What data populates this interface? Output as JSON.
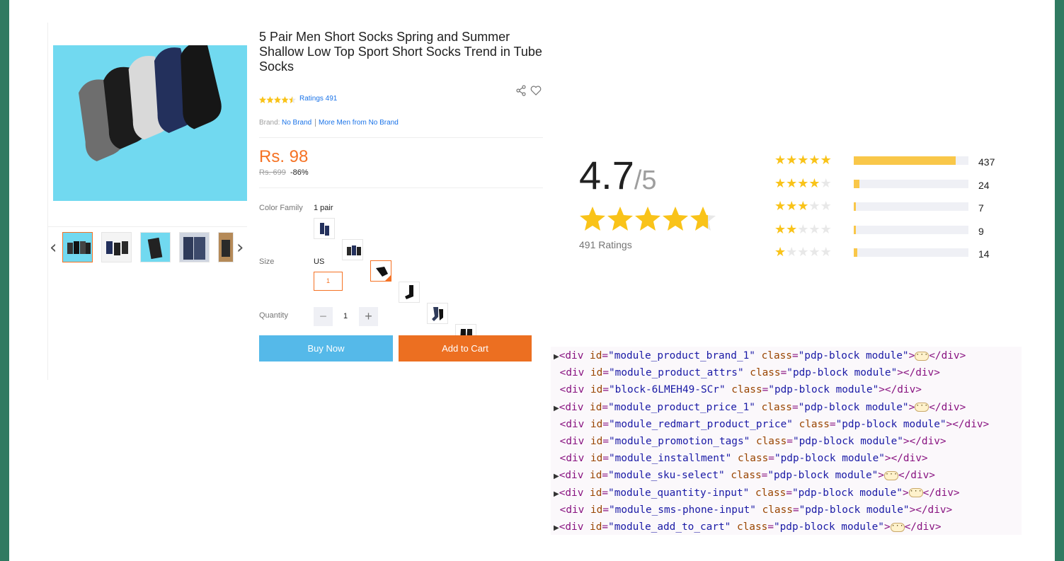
{
  "product": {
    "title": "5 Pair Men Short Socks Spring and Summer Shallow Low Top Sport Short Socks Trend in Tube Socks",
    "ratings_link": "Ratings 491",
    "brand_label": "Brand:",
    "brand_name": "No Brand",
    "brand_more": "More Men from No Brand",
    "price": "Rs. 98",
    "old_price": "Rs. 699",
    "discount": "-86%",
    "color_label": "Color Family",
    "color_value": "1 pair",
    "size_label": "Size",
    "size_system": "US",
    "size_option": "1",
    "quantity_label": "Quantity",
    "quantity": "1",
    "buy_now": "Buy Now",
    "add_to_cart": "Add to Cart",
    "rating_small": 4.5
  },
  "rating_summary": {
    "score": "4.7",
    "out_of": "/5",
    "average": 4.7,
    "ratings_text": "491 Ratings",
    "breakdown": [
      {
        "stars": 5,
        "count": "437",
        "fraction": 0.89
      },
      {
        "stars": 4,
        "count": "24",
        "fraction": 0.05
      },
      {
        "stars": 3,
        "count": "7",
        "fraction": 0.015
      },
      {
        "stars": 2,
        "count": "9",
        "fraction": 0.018
      },
      {
        "stars": 1,
        "count": "14",
        "fraction": 0.028
      }
    ]
  },
  "devtools_lines": [
    {
      "expandable": true,
      "id": "module_product_brand_1",
      "class": "pdp-block module",
      "collapsed": true
    },
    {
      "expandable": false,
      "id": "module_product_attrs",
      "class": "pdp-block module",
      "collapsed": false
    },
    {
      "expandable": false,
      "id": "block-6LMEH49-SCr",
      "class": "pdp-block module",
      "collapsed": false
    },
    {
      "expandable": true,
      "id": "module_product_price_1",
      "class": "pdp-block module",
      "collapsed": true
    },
    {
      "expandable": false,
      "id": "module_redmart_product_price",
      "class": "pdp-block module",
      "collapsed": false
    },
    {
      "expandable": false,
      "id": "module_promotion_tags",
      "class": "pdp-block module",
      "collapsed": false
    },
    {
      "expandable": false,
      "id": "module_installment",
      "class": "pdp-block module",
      "collapsed": false
    },
    {
      "expandable": true,
      "id": "module_sku-select",
      "class": "pdp-block module",
      "collapsed": true
    },
    {
      "expandable": true,
      "id": "module_quantity-input",
      "class": "pdp-block module",
      "collapsed": true
    },
    {
      "expandable": false,
      "id": "module_sms-phone-input",
      "class": "pdp-block module",
      "collapsed": false
    },
    {
      "expandable": true,
      "id": "module_add_to_cart",
      "class": "pdp-block module",
      "collapsed": true
    }
  ],
  "icons": {
    "share": "share-icon",
    "wishlist": "heart-icon",
    "prev": "chevron-left-icon",
    "next": "chevron-right-icon"
  },
  "colors": {
    "accent": "#f57224",
    "buy_now": "#55b9e9",
    "add_to_cart": "#ec6f21",
    "star": "#f9c319",
    "background": "#307a61"
  }
}
